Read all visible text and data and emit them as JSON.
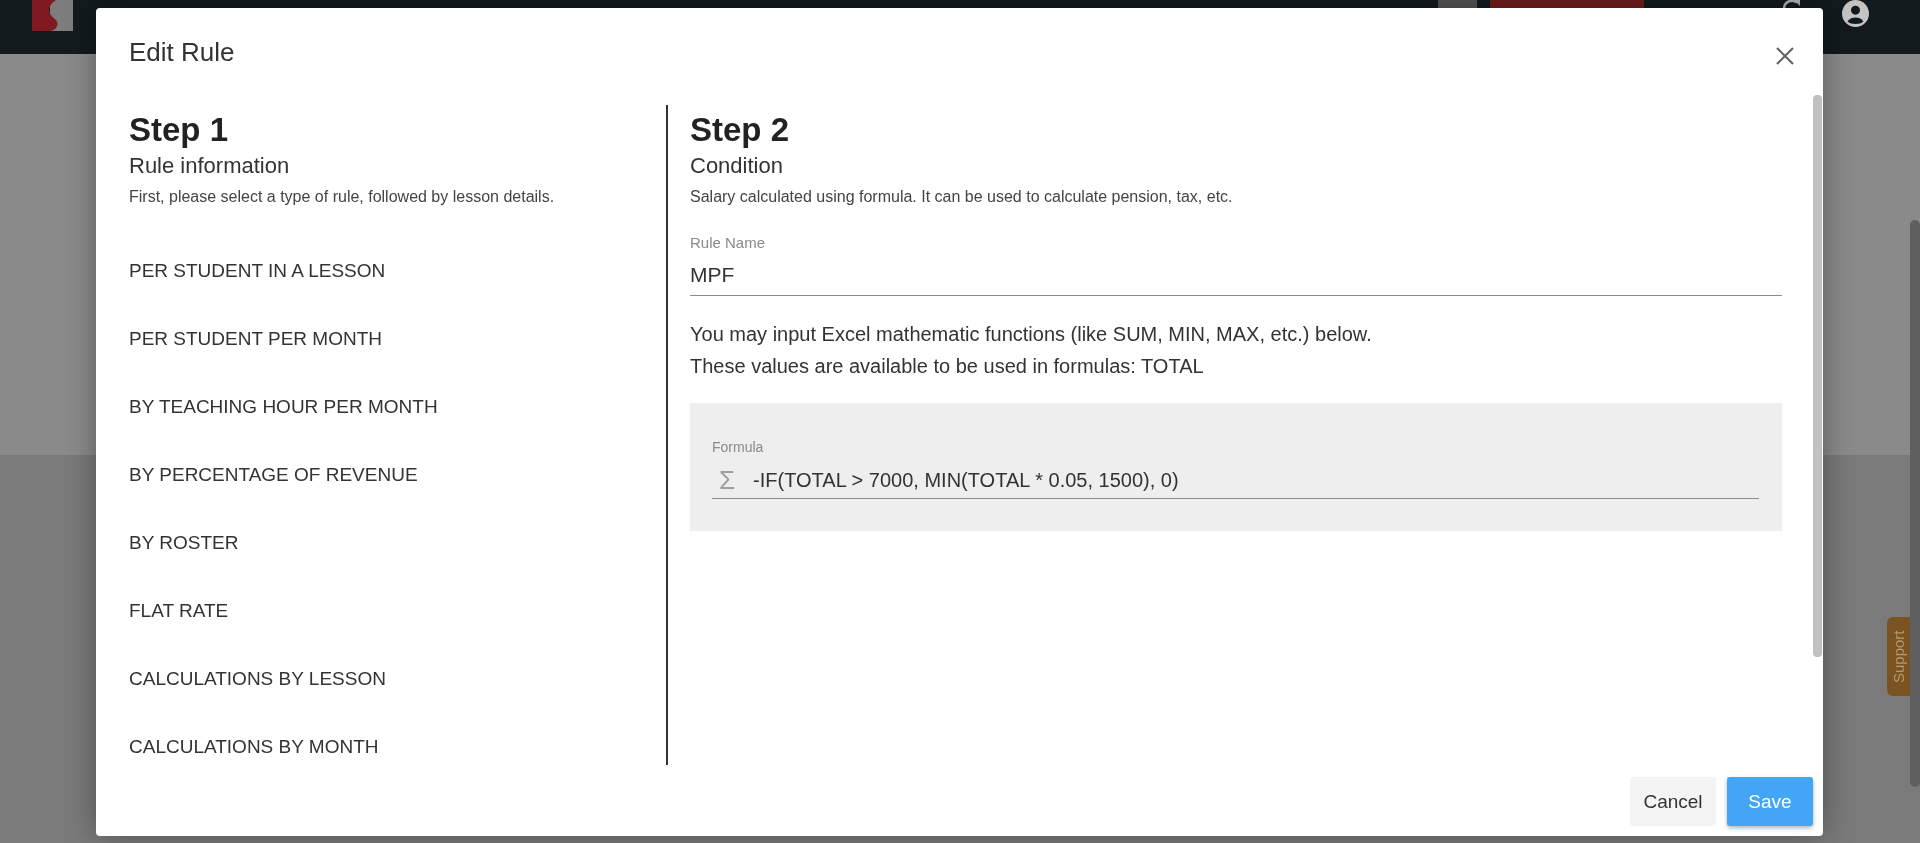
{
  "modal": {
    "title": "Edit Rule"
  },
  "step1": {
    "heading": "Step 1",
    "subheading": "Rule information",
    "description": "First, please select a type of rule, followed by lesson details.",
    "rule_types": [
      {
        "label": "PER STUDENT IN A LESSON",
        "selected": false
      },
      {
        "label": "PER STUDENT PER MONTH",
        "selected": false
      },
      {
        "label": "BY TEACHING HOUR PER MONTH",
        "selected": false
      },
      {
        "label": "BY PERCENTAGE OF REVENUE",
        "selected": false
      },
      {
        "label": "BY ROSTER",
        "selected": false
      },
      {
        "label": "FLAT RATE",
        "selected": false
      },
      {
        "label": "CALCULATIONS BY LESSON",
        "selected": false
      },
      {
        "label": "CALCULATIONS BY MONTH",
        "selected": false
      }
    ]
  },
  "step2": {
    "heading": "Step 2",
    "subheading": "Condition",
    "description": "Salary calculated using formula. It can be used to calculate pension, tax, etc.",
    "rule_name": {
      "label": "Rule Name",
      "value": "MPF"
    },
    "help": [
      "You may input Excel mathematic functions (like SUM, MIN, MAX, etc.) below.",
      "These values are available to be used in formulas: TOTAL"
    ],
    "formula": {
      "label": "Formula",
      "icon": "Σ",
      "value": "-IF(TOTAL > 7000, MIN(TOTAL * 0.05, 1500), 0)"
    }
  },
  "buttons": [
    {
      "label": "Cancel",
      "kind": "secondary"
    },
    {
      "label": "Save",
      "kind": "primary"
    }
  ],
  "support_tab": {
    "label": "Support"
  }
}
